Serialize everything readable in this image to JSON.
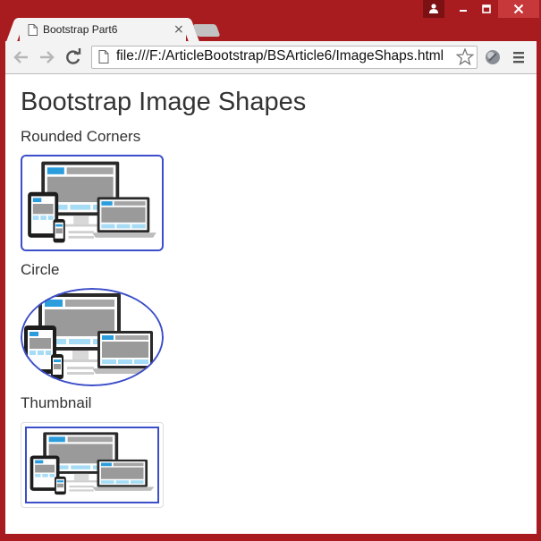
{
  "browser": {
    "tab_title": "Bootstrap Part6",
    "tab_close": "×",
    "url": "file:///F:/ArticleBootstrap/BSArticle6/ImageShaps.html"
  },
  "page": {
    "heading": "Bootstrap Image Shapes",
    "sections": [
      {
        "label": "Rounded Corners"
      },
      {
        "label": "Circle"
      },
      {
        "label": "Thumbnail"
      }
    ]
  },
  "colors": {
    "frame": "#a81c20",
    "image_border": "#3c4ec9"
  },
  "icons": [
    "user-icon",
    "minimize-icon",
    "maximize-icon",
    "close-icon",
    "page-icon",
    "back-arrow-icon",
    "forward-arrow-icon",
    "reload-icon",
    "star-icon",
    "extension-icon",
    "menu-icon"
  ]
}
